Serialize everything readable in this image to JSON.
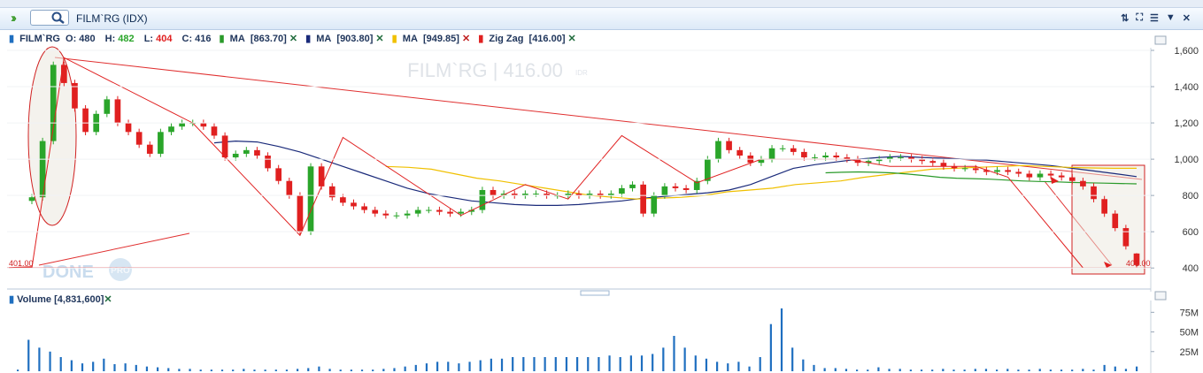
{
  "window": {
    "title": "FILM`RG (IDX)",
    "expand_icon": "double-chevron-right-icon",
    "search_icon": "search-icon",
    "toolbar_icons": [
      "sort-icon",
      "fullscreen-icon",
      "hamburger-icon",
      "dropdown-icon",
      "close-icon"
    ]
  },
  "legend": {
    "symbol": "FILM`RG",
    "open_label": "O:",
    "open": "480",
    "high_label": "H:",
    "high": "482",
    "low_label": "L:",
    "low": "404",
    "close_label": "C:",
    "close": "416",
    "indicators": [
      {
        "name": "MA",
        "value": "[863.70]",
        "color": "#2a9a2a"
      },
      {
        "name": "MA",
        "value": "[903.80]",
        "color": "#1a2a7a"
      },
      {
        "name": "MA",
        "value": "[949.85]",
        "color": "#f0c000"
      },
      {
        "name": "Zig Zag",
        "value": "[416.00]",
        "color": "#e02020"
      }
    ],
    "volume_label": "Volume",
    "volume_value": "[4,831,600]"
  },
  "watermark": {
    "text": "FILM`RG | 416.00",
    "currency": "IDR",
    "brand": "DONE",
    "brand_badge": "PRO"
  },
  "colors": {
    "up": "#2aa52a",
    "down": "#e02020",
    "ma_fast": "#2a9a2a",
    "ma_mid": "#1a2a7a",
    "ma_slow": "#f0c000",
    "zigzag": "#e02020",
    "volume": "#1f6fc0",
    "annotation": "#cc2222"
  },
  "chart_data": [
    {
      "type": "candlestick",
      "symbol": "FILM`RG (IDX)",
      "y_ticks": [
        "1,600",
        "1,400",
        "1,200",
        "1,000",
        "800",
        "600",
        "400"
      ],
      "ylim": [
        340,
        1660
      ],
      "horizontal_line": {
        "value": 401,
        "label": "401.00"
      },
      "last": {
        "open": 480,
        "high": 482,
        "low": 404,
        "close": 416
      },
      "close_series": [
        790,
        1100,
        1520,
        1420,
        1280,
        1150,
        1250,
        1330,
        1200,
        1150,
        1080,
        1030,
        1150,
        1180,
        1200,
        1200,
        1180,
        1130,
        1010,
        1030,
        1050,
        1020,
        950,
        880,
        800,
        600,
        960,
        850,
        790,
        760,
        740,
        720,
        700,
        690,
        690,
        700,
        720,
        720,
        710,
        700,
        710,
        720,
        830,
        800,
        810,
        800,
        810,
        810,
        800,
        800,
        810,
        800,
        810,
        800,
        810,
        840,
        860,
        700,
        800,
        850,
        840,
        830,
        880,
        1000,
        1100,
        1050,
        1020,
        980,
        1000,
        1060,
        1060,
        1040,
        1010,
        1010,
        1020,
        1010,
        1000,
        980,
        990,
        1000,
        1010,
        1010,
        1000,
        990,
        980,
        960,
        950,
        950,
        940,
        930,
        940,
        930,
        920,
        900,
        920,
        910,
        900,
        880,
        850,
        780,
        700,
        620,
        520,
        416
      ],
      "ma_fast": {
        "name": "MA",
        "value": 863.7,
        "from_index": 74,
        "points": [
          925,
          928,
          930,
          928,
          925,
          918,
          910,
          900,
          895,
          893,
          890,
          885,
          880,
          877,
          875,
          872,
          870,
          868,
          866,
          864
        ]
      },
      "ma_mid": {
        "name": "MA",
        "value": 903.8,
        "from_index": 17,
        "points": [
          1090,
          1100,
          1095,
          1070,
          1040,
          1000,
          960,
          920,
          880,
          840,
          810,
          790,
          770,
          760,
          750,
          745,
          745,
          750,
          760,
          770,
          785,
          795,
          805,
          815,
          830,
          860,
          905,
          950,
          970,
          985,
          1000,
          1010,
          1015,
          1010,
          1005,
          1000,
          995,
          985,
          975,
          965,
          950,
          935,
          920,
          903.8
        ]
      },
      "ma_slow": {
        "name": "MA",
        "value": 949.85,
        "from_index": 33,
        "points": [
          960,
          955,
          945,
          920,
          895,
          880,
          860,
          840,
          820,
          800,
          790,
          780,
          785,
          790,
          800,
          820,
          830,
          840,
          860,
          870,
          880,
          900,
          915,
          930,
          945,
          950,
          955,
          960,
          965,
          960,
          955,
          952,
          950,
          949.85
        ]
      },
      "zigzag": {
        "name": "Zig Zag",
        "value": 416.0,
        "points": [
          [
            0,
            401
          ],
          [
            3,
            1560
          ],
          [
            15,
            1200
          ],
          [
            25,
            580
          ],
          [
            29,
            1120
          ],
          [
            40,
            690
          ],
          [
            46,
            860
          ],
          [
            50,
            780
          ],
          [
            55,
            1130
          ],
          [
            62,
            870
          ],
          [
            68,
            1000
          ],
          [
            76,
            1000
          ],
          [
            80,
            960
          ],
          [
            88,
            960
          ],
          [
            91,
            901
          ],
          [
            98,
            401
          ]
        ]
      }
    },
    {
      "type": "bar",
      "title": "Volume",
      "last_value": "[4,831,600]",
      "y_ticks": [
        "75M",
        "50M",
        "25M"
      ],
      "ylim": [
        0,
        90
      ],
      "values_m": [
        2,
        40,
        30,
        25,
        18,
        14,
        10,
        12,
        16,
        9,
        10,
        8,
        6,
        5,
        4,
        3,
        3,
        2,
        2,
        2,
        2,
        3,
        2,
        2,
        2,
        2,
        3,
        4,
        6,
        3,
        2,
        2,
        2,
        2,
        3,
        4,
        6,
        8,
        10,
        12,
        12,
        10,
        12,
        14,
        16,
        16,
        18,
        18,
        18,
        18,
        18,
        18,
        18,
        18,
        18,
        20,
        18,
        20,
        20,
        22,
        30,
        45,
        30,
        20,
        16,
        12,
        10,
        12,
        6,
        18,
        60,
        80,
        30,
        15,
        8,
        4,
        4,
        3,
        2,
        2,
        5,
        3,
        3,
        2,
        2,
        2,
        3,
        2,
        2,
        3,
        3,
        2,
        3,
        2,
        2,
        3,
        2,
        2,
        2,
        3,
        2,
        8,
        6,
        3,
        6
      ]
    }
  ]
}
